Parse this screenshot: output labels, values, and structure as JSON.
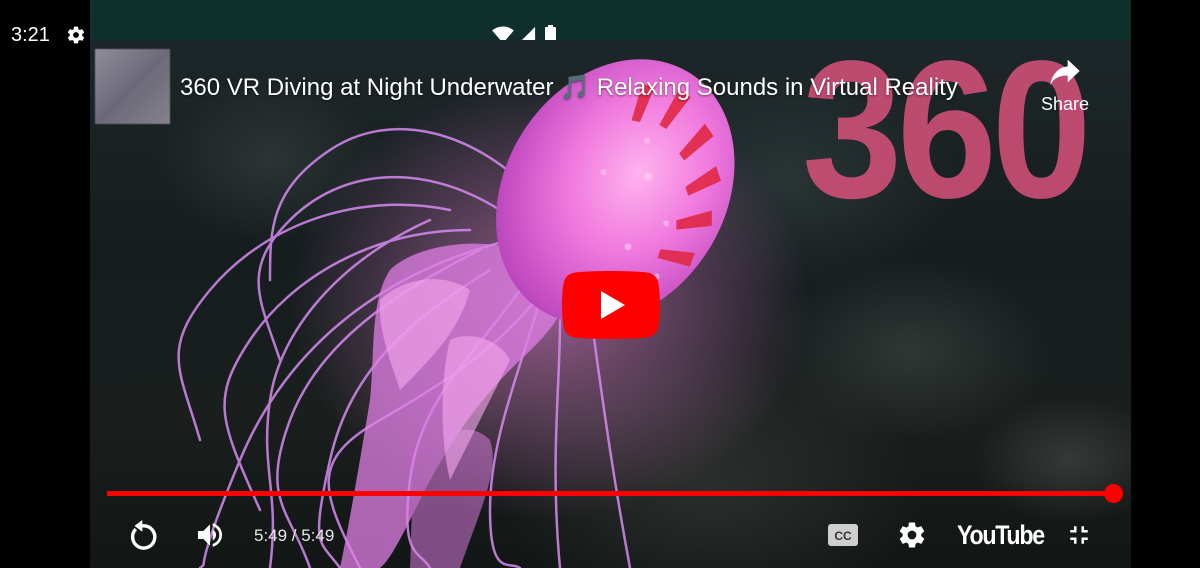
{
  "status_bar": {
    "time": "3:21",
    "icons": [
      "gear-icon",
      "notification-dot",
      "wifi-icon",
      "signal-icon",
      "battery-icon"
    ]
  },
  "video": {
    "title": "360 VR Diving at Night Underwater 🎵 Relaxing Sounds in Virtual Reality",
    "overlay_text": "360",
    "share_label": "Share",
    "time_display": "5:49 / 5:49",
    "progress": 1.0,
    "brand_label": "YouTube",
    "colors": {
      "accent": "#ff0000",
      "overlay_text": "#d9527c",
      "status_bar_bg": "#0f2f2c"
    }
  },
  "controls": [
    "replay-icon",
    "volume-icon",
    "closed-captions-icon",
    "settings-gear-icon",
    "youtube-logo",
    "exit-fullscreen-icon"
  ]
}
